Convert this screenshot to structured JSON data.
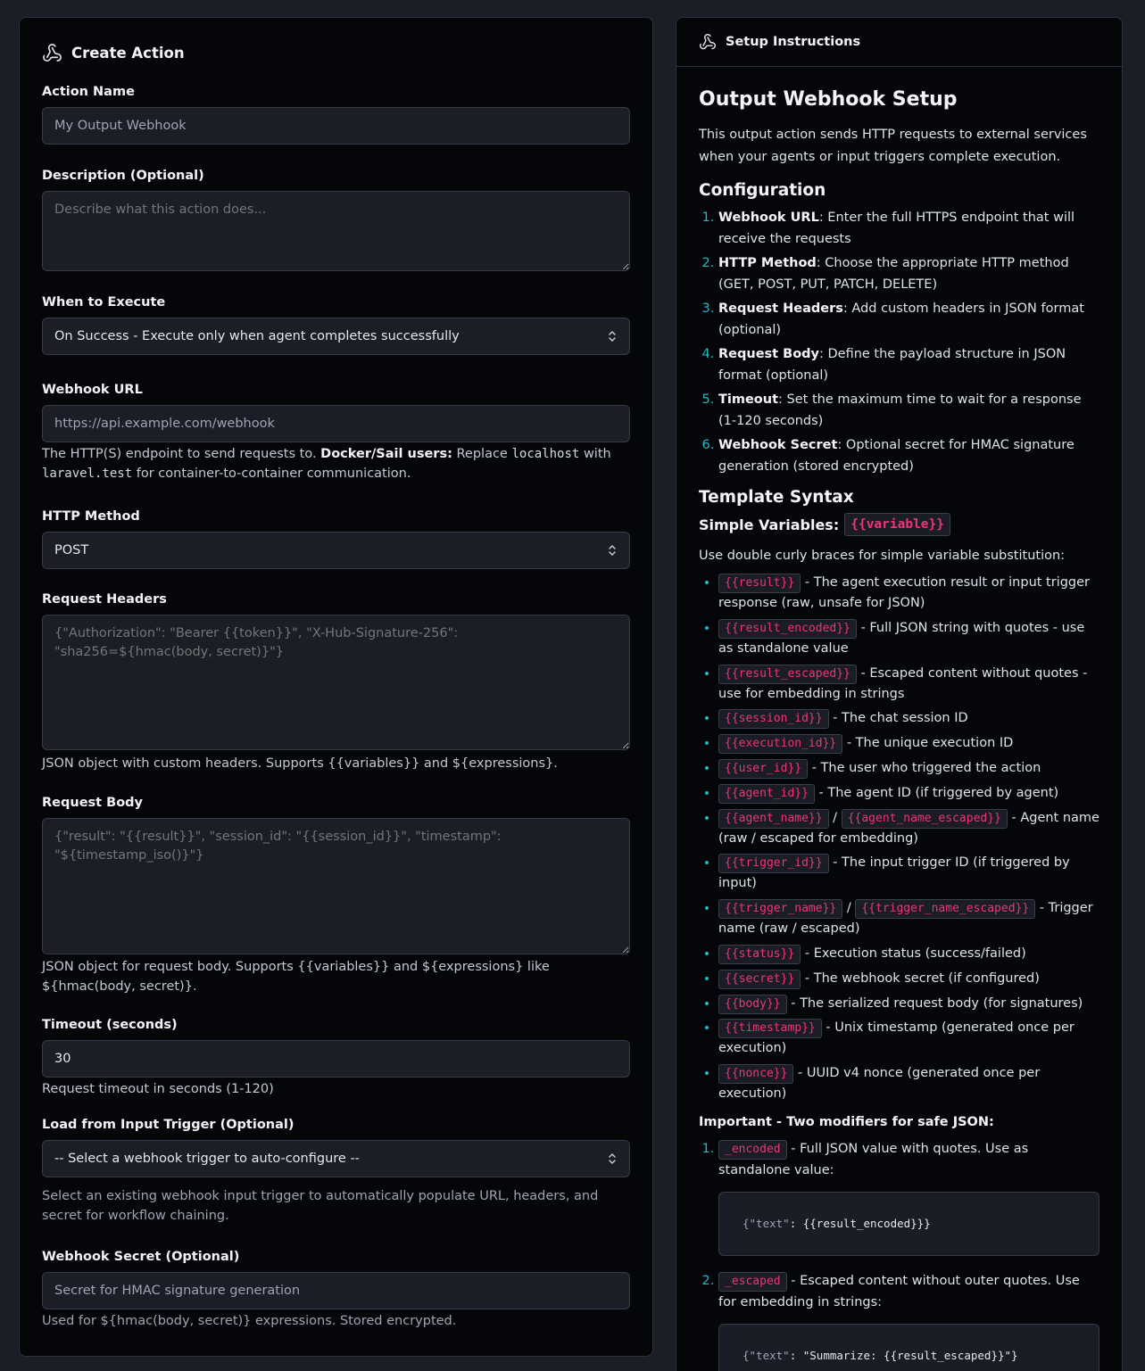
{
  "left": {
    "title": "Create Action",
    "action_name": {
      "label": "Action Name",
      "placeholder": "My Output Webhook"
    },
    "description": {
      "label": "Description (Optional)",
      "placeholder": "Describe what this action does..."
    },
    "when": {
      "label": "When to Execute",
      "value": "On Success - Execute only when agent completes successfully"
    },
    "url": {
      "label": "Webhook URL",
      "placeholder": "https://api.example.com/webhook",
      "help_1": "The HTTP(S) endpoint to send requests to.",
      "help_bold": "Docker/Sail users:",
      "help_2": "Replace",
      "help_code1": "localhost",
      "help_3": "with",
      "help_code2": "laravel.test",
      "help_4": "for container-to-container communication."
    },
    "method": {
      "label": "HTTP Method",
      "value": "POST"
    },
    "headers": {
      "label": "Request Headers",
      "placeholder": "{\"Authorization\": \"Bearer {{token}}\", \"X-Hub-Signature-256\": \"sha256=${hmac(body, secret)}\"}",
      "help": "JSON object with custom headers. Supports {{variables}} and ${expressions}."
    },
    "body": {
      "label": "Request Body",
      "placeholder": "{\"result\": \"{{result}}\", \"session_id\": \"{{session_id}}\", \"timestamp\": \"${timestamp_iso()}\"}",
      "help": "JSON object for request body. Supports {{variables}} and ${expressions} like ${hmac(body, secret)}."
    },
    "timeout": {
      "label": "Timeout (seconds)",
      "value": "30",
      "help": "Request timeout in seconds (1-120)"
    },
    "trigger": {
      "label": "Load from Input Trigger (Optional)",
      "value": "-- Select a webhook trigger to auto-configure --",
      "help": "Select an existing webhook input trigger to automatically populate URL, headers, and secret for workflow chaining."
    },
    "secret": {
      "label": "Webhook Secret (Optional)",
      "placeholder": "Secret for HMAC signature generation",
      "help": "Used for ${hmac(body, secret)} expressions. Stored encrypted."
    }
  },
  "right": {
    "header": "Setup Instructions",
    "h1": "Output Webhook Setup",
    "intro": "This output action sends HTTP requests to external services when your agents or input triggers complete execution.",
    "config_title": "Configuration",
    "config": [
      {
        "b": "Webhook URL",
        "t": ": Enter the full HTTPS endpoint that will receive the requests"
      },
      {
        "b": "HTTP Method",
        "t": ": Choose the appropriate HTTP method (GET, POST, PUT, PATCH, DELETE)"
      },
      {
        "b": "Request Headers",
        "t": ": Add custom headers in JSON format (optional)"
      },
      {
        "b": "Request Body",
        "t": ": Define the payload structure in JSON format (optional)"
      },
      {
        "b": "Timeout",
        "t": ": Set the maximum time to wait for a response (1-120 seconds)"
      },
      {
        "b": "Webhook Secret",
        "t": ": Optional secret for HMAC signature generation (stored encrypted)"
      }
    ],
    "template_title": "Template Syntax",
    "simple_label": "Simple Variables:",
    "simple_token": "{{variable}}",
    "simple_desc": "Use double curly braces for simple variable substitution:",
    "vars": [
      {
        "tok": "{{result}}",
        "t": " - The agent execution result or input trigger response (raw, unsafe for JSON)"
      },
      {
        "tok": "{{result_encoded}}",
        "t": " - Full JSON string with quotes - use as standalone value"
      },
      {
        "tok": "{{result_escaped}}",
        "t": " - Escaped content without quotes - use for embedding in strings"
      },
      {
        "tok": "{{session_id}}",
        "t": " - The chat session ID"
      },
      {
        "tok": "{{execution_id}}",
        "t": " - The unique execution ID"
      },
      {
        "tok": "{{user_id}}",
        "t": " - The user who triggered the action"
      },
      {
        "tok": "{{agent_id}}",
        "t": " - The agent ID (if triggered by agent)"
      },
      {
        "tok": "{{agent_name}}",
        "sep": " / ",
        "tok2": "{{agent_name_escaped}}",
        "t": " - Agent name (raw / escaped for embedding)"
      },
      {
        "tok": "{{trigger_id}}",
        "t": " - The input trigger ID (if triggered by input)"
      },
      {
        "tok": "{{trigger_name}}",
        "sep": " / ",
        "tok2": "{{trigger_name_escaped}}",
        "t": " - Trigger name (raw / escaped)"
      },
      {
        "tok": "{{status}}",
        "t": " - Execution status (success/failed)"
      },
      {
        "tok": "{{secret}}",
        "t": " - The webhook secret (if configured)"
      },
      {
        "tok": "{{body}}",
        "t": " - The serialized request body (for signatures)"
      },
      {
        "tok": "{{timestamp}}",
        "t": " - Unix timestamp (generated once per execution)"
      },
      {
        "tok": "{{nonce}}",
        "t": " - UUID v4 nonce (generated once per execution)"
      }
    ],
    "important": "Important - Two modifiers for safe JSON:",
    "modifiers": [
      {
        "tok": "_encoded",
        "t": " - Full JSON value with quotes. Use as standalone value:",
        "code_key": "{\"text\"",
        "code_rest": ": {{result_encoded}}}"
      },
      {
        "tok": "_escaped",
        "t": " - Escaped content without outer quotes. Use for embedding in strings:",
        "code_key": "{\"text\"",
        "code_rest": ": \"Summarize: {{result_escaped}}\"}"
      }
    ]
  }
}
